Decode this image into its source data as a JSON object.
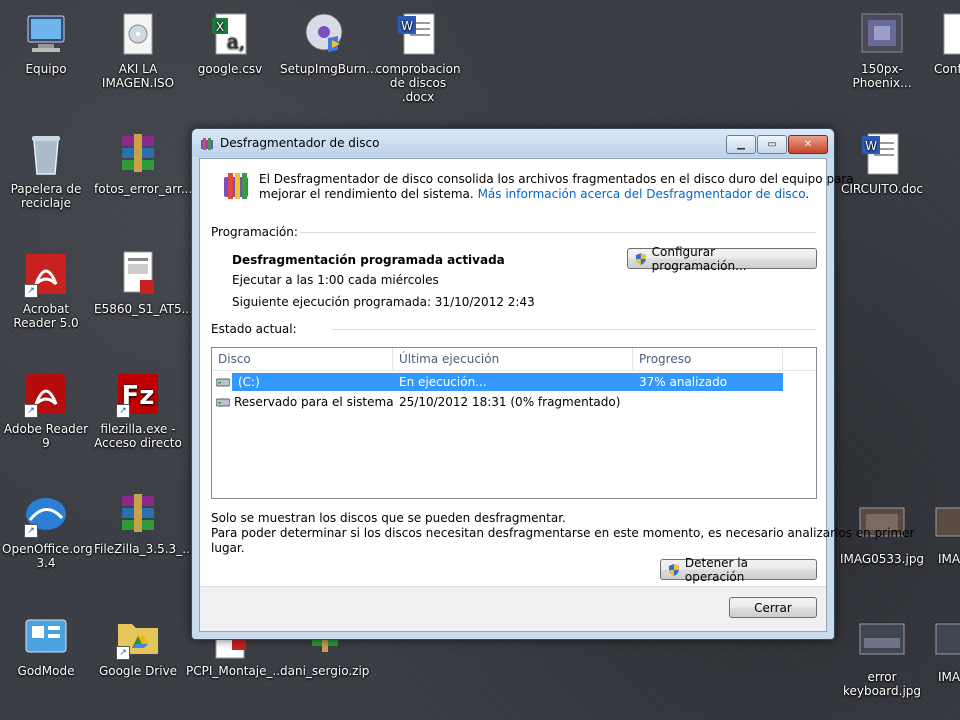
{
  "desktop": {
    "icons": [
      {
        "label": "Equipo"
      },
      {
        "label": "AKI LA IMAGEN.ISO"
      },
      {
        "label": "google.csv"
      },
      {
        "label": "SetupImgBurn..."
      },
      {
        "label": "comprobacion de discos .docx"
      },
      {
        "label": "150px-Phoenix..."
      },
      {
        "label": "Conf"
      },
      {
        "label": "Papelera de reciclaje"
      },
      {
        "label": "fotos_error_arr..."
      },
      {
        "label": "CIRCUITO.doc"
      },
      {
        "label": "Acrobat Reader 5.0"
      },
      {
        "label": "E5860_S1_AT5..."
      },
      {
        "label": "Adobe Reader 9"
      },
      {
        "label": "filezilla.exe - Acceso directo"
      },
      {
        "label": "OpenOffice.org 3.4"
      },
      {
        "label": "FileZilla_3.5.3_..."
      },
      {
        "label": "IMAG0533.jpg"
      },
      {
        "label": "IMA"
      },
      {
        "label": "GodMode"
      },
      {
        "label": "Google Drive"
      },
      {
        "label": "PCPI_Montaje_..."
      },
      {
        "label": "dani_sergio.zip"
      },
      {
        "label": "error keyboard.jpg"
      },
      {
        "label": "IMA"
      }
    ]
  },
  "window": {
    "title": "Desfragmentador de disco",
    "intro_line1": "El Desfragmentador de disco consolida los archivos fragmentados en el disco duro del equipo para",
    "intro_line2": "mejorar el rendimiento del sistema.",
    "intro_link": "Más información acerca del Desfragmentador de disco",
    "intro_period": ".",
    "schedule_header": "Programación:",
    "schedule_status": "Desfragmentación programada activada",
    "schedule_run": "Ejecutar a las 1:00 cada miércoles",
    "schedule_next": "Siguiente ejecución programada: 31/10/2012 2:43",
    "configure_button": "Configurar programación...",
    "current_header": "Estado actual:",
    "columns": [
      "Disco",
      "Última ejecución",
      "Progreso"
    ],
    "rows": [
      {
        "disk": "(C:)",
        "last": "En ejecución...",
        "progress": "37% analizado"
      },
      {
        "disk": "Reservado para el sistema",
        "last": "25/10/2012 18:31 (0% fragmentado)",
        "progress": ""
      }
    ],
    "note1": "Solo se muestran los discos que se pueden desfragmentar.",
    "note2": "Para poder determinar si los discos necesitan desfragmentarse en este momento, es necesario analizarlos en primer",
    "note3": "lugar.",
    "stop_button": "Detener la operación",
    "close_button": "Cerrar"
  }
}
